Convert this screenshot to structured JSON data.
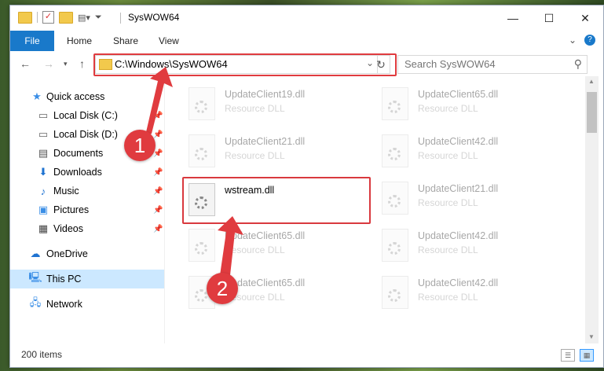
{
  "window": {
    "title": "SysWOW64",
    "controls": {
      "minimize": "—",
      "maximize": "☐",
      "close": "✕"
    }
  },
  "ribbon": {
    "tabs": [
      "File",
      "Home",
      "Share",
      "View"
    ],
    "expand_glyph": "⌄",
    "help_glyph": "?"
  },
  "nav": {
    "address_path": "C:\\Windows\\SysWOW64",
    "search_placeholder": "Search SysWOW64"
  },
  "sidebar": {
    "items": [
      {
        "label": "Quick access",
        "icon": "star-icon",
        "pinned": false
      },
      {
        "label": "Local Disk (C:)",
        "icon": "drive-icon",
        "pinned": true
      },
      {
        "label": "Local Disk (D:)",
        "icon": "drive-icon",
        "pinned": true
      },
      {
        "label": "Documents",
        "icon": "document-icon",
        "pinned": true
      },
      {
        "label": "Downloads",
        "icon": "download-icon",
        "pinned": true
      },
      {
        "label": "Music",
        "icon": "music-icon",
        "pinned": true
      },
      {
        "label": "Pictures",
        "icon": "pictures-icon",
        "pinned": true
      },
      {
        "label": "Videos",
        "icon": "videos-icon",
        "pinned": true
      },
      {
        "label": "OneDrive",
        "icon": "cloud-icon",
        "pinned": false
      },
      {
        "label": "This PC",
        "icon": "computer-icon",
        "pinned": false,
        "selected": true
      },
      {
        "label": "Network",
        "icon": "network-icon",
        "pinned": false
      }
    ]
  },
  "files": {
    "left": [
      {
        "name": "UpdateClient19.dll",
        "type": "Resource DLL"
      },
      {
        "name": "UpdateClient21.dll",
        "type": "Resource DLL"
      },
      {
        "name": "wstream.dll",
        "type": ""
      },
      {
        "name": "UpdateClient65.dll",
        "type": "Resource DLL"
      },
      {
        "name": "UpdateClient65.dll",
        "type": "Resource DLL"
      }
    ],
    "right": [
      {
        "name": "UpdateClient65.dll",
        "type": "Resource DLL"
      },
      {
        "name": "UpdateClient42.dll",
        "type": "Resource DLL"
      },
      {
        "name": "UpdateClient21.dll",
        "type": "Resource DLL"
      },
      {
        "name": "UpdateClient42.dll",
        "type": "Resource DLL"
      },
      {
        "name": "UpdateClient42.dll",
        "type": "Resource DLL"
      }
    ]
  },
  "status": {
    "item_count": "200 items"
  },
  "annotations": {
    "step1": "1",
    "step2": "2",
    "accent": "#e03b3f"
  }
}
